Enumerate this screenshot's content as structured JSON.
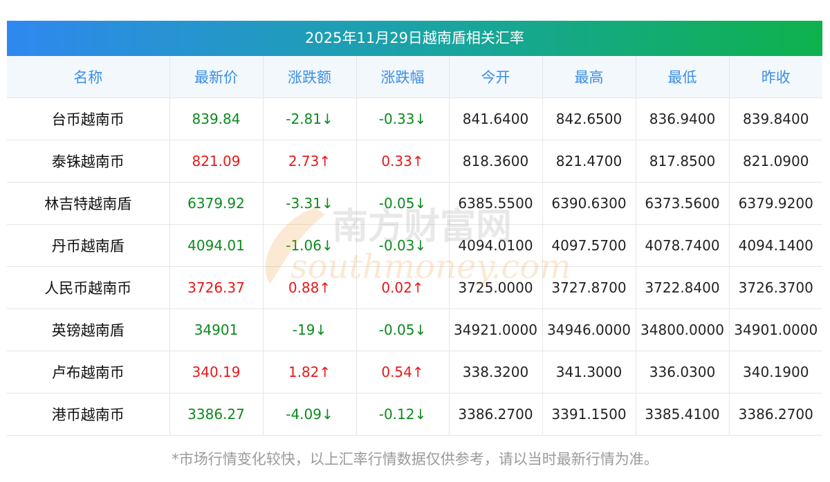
{
  "title": "2025年11月29日越南盾相关汇率",
  "columns": [
    "名称",
    "最新价",
    "涨跌额",
    "涨跌幅",
    "今开",
    "最高",
    "最低",
    "昨收"
  ],
  "rows": [
    {
      "name": "台币越南币",
      "latest": "839.84",
      "change": "-2.81↓",
      "pct": "-0.33↓",
      "open": "841.6400",
      "high": "842.6500",
      "low": "836.9400",
      "prev": "839.8400",
      "dir": "down"
    },
    {
      "name": "泰铢越南币",
      "latest": "821.09",
      "change": "2.73↑",
      "pct": "0.33↑",
      "open": "818.3600",
      "high": "821.4700",
      "low": "817.8500",
      "prev": "821.0900",
      "dir": "up"
    },
    {
      "name": "林吉特越南盾",
      "latest": "6379.92",
      "change": "-3.31↓",
      "pct": "-0.05↓",
      "open": "6385.5500",
      "high": "6390.6300",
      "low": "6373.5600",
      "prev": "6379.9200",
      "dir": "down"
    },
    {
      "name": "丹币越南盾",
      "latest": "4094.01",
      "change": "-1.06↓",
      "pct": "-0.03↓",
      "open": "4094.0100",
      "high": "4097.5700",
      "low": "4078.7400",
      "prev": "4094.1400",
      "dir": "down"
    },
    {
      "name": "人民币越南币",
      "latest": "3726.37",
      "change": "0.88↑",
      "pct": "0.02↑",
      "open": "3725.0000",
      "high": "3727.8700",
      "low": "3722.8400",
      "prev": "3726.3700",
      "dir": "up"
    },
    {
      "name": "英镑越南盾",
      "latest": "34901",
      "change": "-19↓",
      "pct": "-0.05↓",
      "open": "34921.0000",
      "high": "34946.0000",
      "low": "34800.0000",
      "prev": "34901.0000",
      "dir": "down"
    },
    {
      "name": "卢布越南币",
      "latest": "340.19",
      "change": "1.82↑",
      "pct": "0.54↑",
      "open": "338.3200",
      "high": "341.3000",
      "low": "336.0300",
      "prev": "340.1900",
      "dir": "up"
    },
    {
      "name": "港币越南币",
      "latest": "3386.27",
      "change": "-4.09↓",
      "pct": "-0.12↓",
      "open": "3386.2700",
      "high": "3391.1500",
      "low": "3385.4100",
      "prev": "3386.2700",
      "dir": "down"
    }
  ],
  "watermark": {
    "cn": "南方财富网",
    "en": "southmoney.com"
  },
  "footer": "*市场行情变化较快，以上汇率行情数据仅供参考，请以当时最新行情为准。",
  "colors": {
    "down": "#0b8a1c",
    "up": "#e81818",
    "header_text": "#3a8ee6",
    "gradient_start": "#2f88f0",
    "gradient_end": "#0eb24c"
  }
}
